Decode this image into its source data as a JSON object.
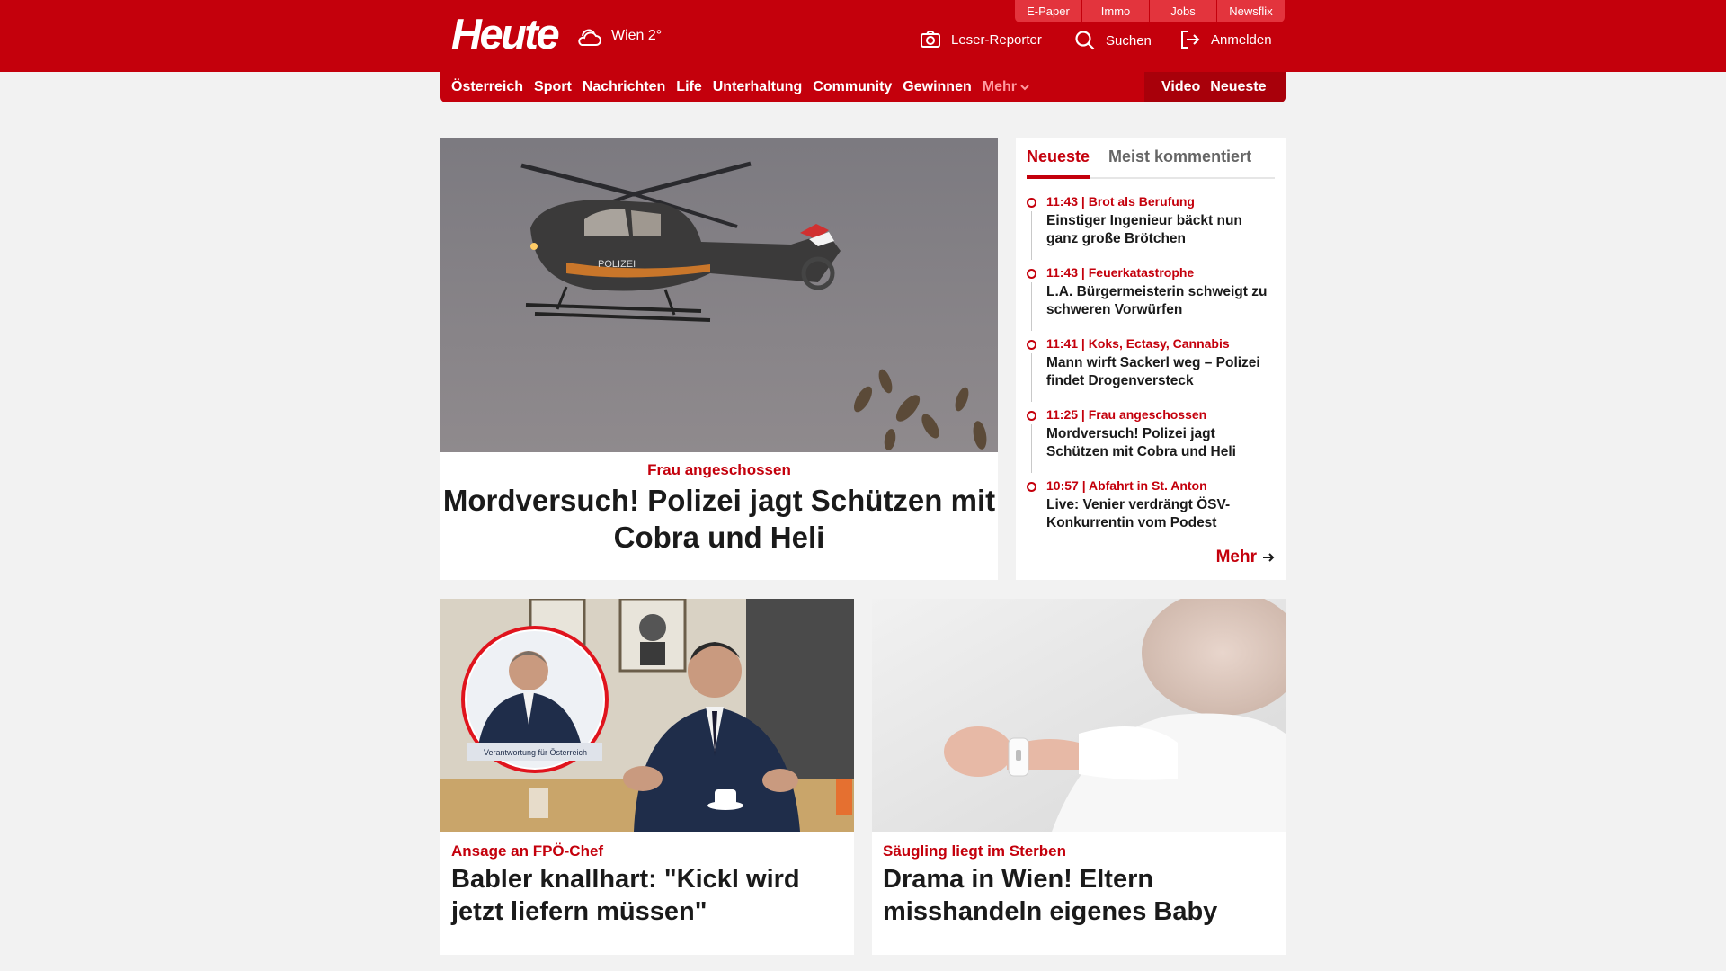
{
  "header": {
    "logo": "Heute",
    "weather": {
      "icon": "cloud-sun-icon",
      "label": "Wien 2°"
    },
    "top_tabs": [
      "E-Paper",
      "Immo",
      "Jobs",
      "Newsflix"
    ],
    "actions": {
      "reporter": "Leser-Reporter",
      "search": "Suchen",
      "login": "Anmelden"
    }
  },
  "nav": {
    "items": [
      "Österreich",
      "Sport",
      "Nachrichten",
      "Life",
      "Unterhaltung",
      "Community",
      "Gewinnen"
    ],
    "more": "Mehr",
    "right": [
      "Video",
      "Neueste"
    ]
  },
  "hero": {
    "topic": "Frau angeschossen",
    "title": "Mordversuch! Polizei jagt Schützen mit Cobra und Heli"
  },
  "ticker": {
    "tabs": [
      "Neueste",
      "Meist kommentiert"
    ],
    "items": [
      {
        "meta": "11:43 | Brot als Berufung",
        "title": "Einstiger Ingenieur bäckt nun ganz große Brötchen"
      },
      {
        "meta": "11:43 | Feuerkatastrophe",
        "title": "L.A. Bürgermeisterin schweigt zu schweren Vorwürfen"
      },
      {
        "meta": "11:41 | Koks, Ectasy, Cannabis",
        "title": "Mann wirft Sackerl weg – Polizei findet Drogenversteck"
      },
      {
        "meta": "11:25 | Frau angeschossen",
        "title": "Mordversuch! Polizei jagt Schützen mit Cobra und Heli"
      },
      {
        "meta": "10:57 | Abfahrt in St. Anton",
        "title": "Live: Venier verdrängt ÖSV-Konkurrentin vom Podest"
      }
    ],
    "more": "Mehr"
  },
  "cards": [
    {
      "topic": "Ansage an FPÖ-Chef",
      "title": "Babler knallhart: \"Kickl wird jetzt liefern müssen\""
    },
    {
      "topic": "Säugling liegt im Sterben",
      "title": "Drama in Wien! Eltern misshandeln eigenes Baby"
    }
  ],
  "colors": {
    "brand": "#c4000c",
    "background": "#f2f2f2"
  }
}
